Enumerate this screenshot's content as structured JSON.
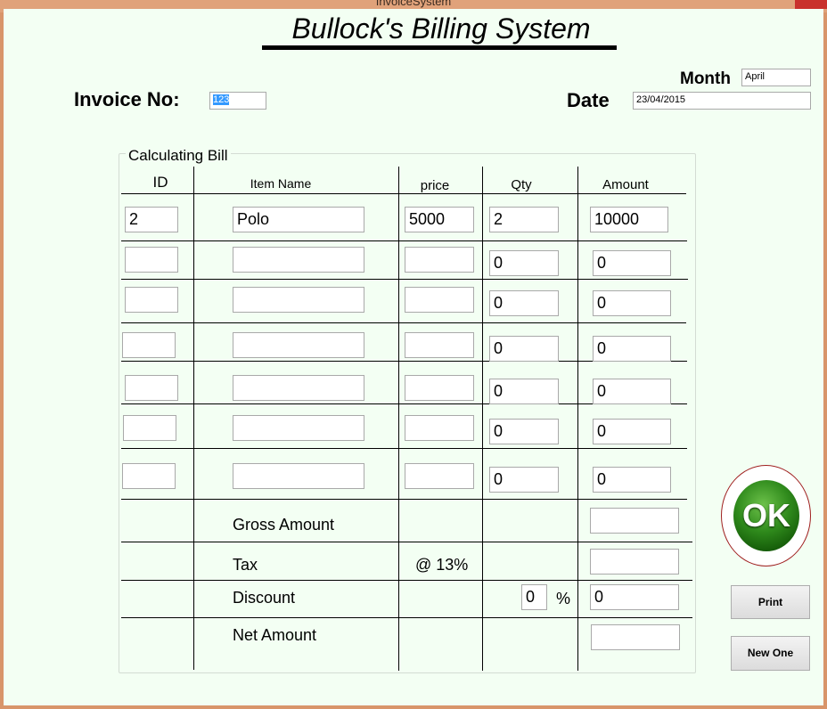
{
  "window": {
    "title": "InvoiceSystem"
  },
  "heading": "Bullock's Billing System",
  "labels": {
    "invoice_no": "Invoice No:",
    "month": "Month",
    "date": "Date"
  },
  "fields": {
    "invoice_no": "123",
    "month": "April",
    "date": "23/04/2015"
  },
  "group_title": "Calculating Bill",
  "columns": {
    "id": "ID",
    "item_name": "Item Name",
    "price": "price",
    "qty": "Qty",
    "amount": "Amount"
  },
  "rows": [
    {
      "id": "2",
      "item_name": "Polo",
      "price": "5000",
      "qty": "2",
      "amount": "10000"
    },
    {
      "id": "",
      "item_name": "",
      "price": "",
      "qty": "0",
      "amount": "0"
    },
    {
      "id": "",
      "item_name": "",
      "price": "",
      "qty": "0",
      "amount": "0"
    },
    {
      "id": "",
      "item_name": "",
      "price": "",
      "qty": "0",
      "amount": "0"
    },
    {
      "id": "",
      "item_name": "",
      "price": "",
      "qty": "0",
      "amount": "0"
    },
    {
      "id": "",
      "item_name": "",
      "price": "",
      "qty": "0",
      "amount": "0"
    },
    {
      "id": "",
      "item_name": "",
      "price": "",
      "qty": "0",
      "amount": "0"
    }
  ],
  "summary": {
    "gross_amount_label": "Gross Amount",
    "tax_label": "Tax",
    "tax_rate": "@ 13%",
    "discount_label": "Discount",
    "discount_percent": "0",
    "percent_sign": "%",
    "discount_value": "0",
    "net_amount_label": "Net Amount",
    "gross_amount_value": "",
    "tax_value": "",
    "net_amount_value": ""
  },
  "buttons": {
    "ok": "OK",
    "print": "Print",
    "new_one": "New One"
  },
  "colors": {
    "background": "#f3fff3",
    "window_frame": "#d8956a",
    "ok_green": "#2f8a1c",
    "selection": "#3399ff"
  }
}
